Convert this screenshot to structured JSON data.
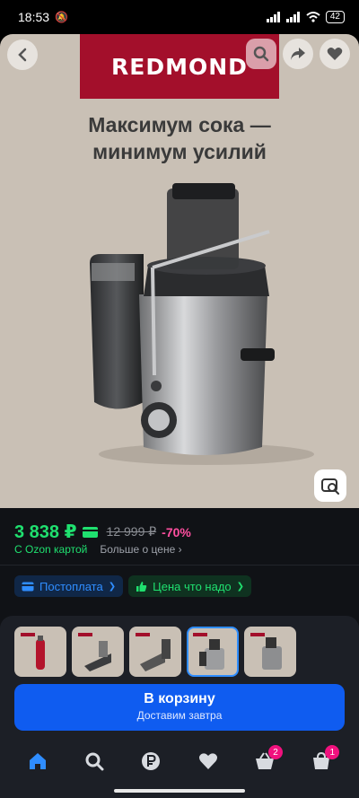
{
  "status": {
    "time": "18:53",
    "battery": "42"
  },
  "product": {
    "brand": "REDMOND",
    "headline_line1": "Максимум сока —",
    "headline_line2": "минимум усилий",
    "side_brand": "REDMOND"
  },
  "price": {
    "current": "3 838 ₽",
    "old": "12 999 ₽",
    "discount": "-70%",
    "ozon_card": "С Ozon картой",
    "more": "Больше о цене"
  },
  "chips": [
    {
      "label": "Постоплата",
      "icon": "card-icon"
    },
    {
      "label": "Цена что надо",
      "icon": "thumbs-up-icon"
    }
  ],
  "thumbnails_count": 5,
  "selected_thumbnail": 4,
  "cart": {
    "title": "В корзину",
    "subtitle": "Доставим завтра"
  },
  "tabbar": {
    "items": [
      "home-icon",
      "search-icon",
      "ruble-icon",
      "heart-icon",
      "basket-icon",
      "bag-icon"
    ],
    "basket_badge": "2",
    "bag_badge": "1"
  },
  "colors": {
    "accent": "#0f5cf0",
    "price": "#1fe06f",
    "discount": "#ff4fa0",
    "brand": "#a30f2b"
  }
}
